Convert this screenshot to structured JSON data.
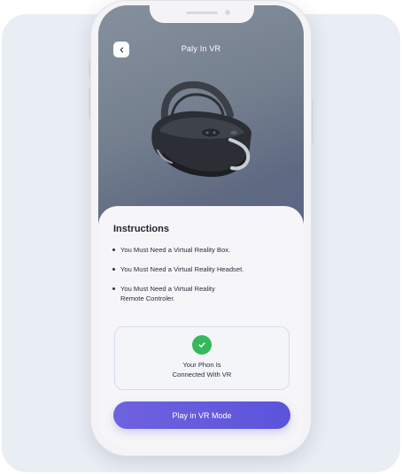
{
  "header": {
    "title": "Paly In VR",
    "back_icon": "chevron-left-icon"
  },
  "hero": {
    "image": "vr-headset-image"
  },
  "instructions": {
    "title": "Instructions",
    "items": [
      {
        "line1": "You Must Need a Virtual Reality Box.",
        "line2": ""
      },
      {
        "line1": "You Must Need a Virtual Reality Headset.",
        "line2": ""
      },
      {
        "line1": "You Must Need a Virtual Reality",
        "line2": "Remote Controler."
      }
    ]
  },
  "status": {
    "icon": "check-circle-icon",
    "line1": "Your Phon Is",
    "line2": "Connected With VR",
    "accent": "#35b85d"
  },
  "cta": {
    "label": "Play in VR Mode",
    "color": "#5b54db"
  }
}
